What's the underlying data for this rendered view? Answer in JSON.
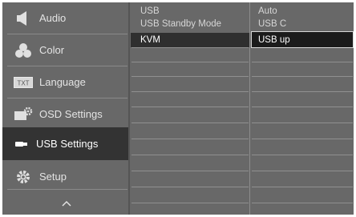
{
  "menu": {
    "items": [
      {
        "label": "Audio",
        "icon": "speaker-icon"
      },
      {
        "label": "Color",
        "icon": "color-palette-icon"
      },
      {
        "label": "Language",
        "icon": "language-txt-icon"
      },
      {
        "label": "OSD Settings",
        "icon": "osd-gear-icon"
      },
      {
        "label": "USB Settings",
        "icon": "usb-plug-icon",
        "selected": true
      },
      {
        "label": "Setup",
        "icon": "gear-icon"
      }
    ],
    "up_arrow": "^"
  },
  "submenu": {
    "items": [
      "USB",
      "USB Standby Mode",
      "KVM"
    ],
    "selected": "KVM"
  },
  "options": {
    "items": [
      "Auto",
      "USB C",
      "USB up"
    ],
    "selected": "USB up"
  },
  "colors": {
    "panel": "#686868",
    "selected_menu": "#333333",
    "selected_option": "#1b1b1b"
  }
}
